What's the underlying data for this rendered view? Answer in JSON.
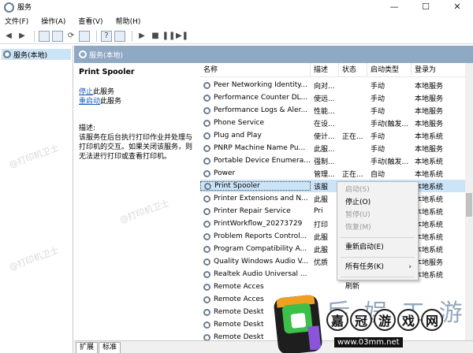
{
  "window": {
    "title": "服务",
    "controls": [
      "—",
      "☐",
      "✕"
    ]
  },
  "menu": [
    "文件(F)",
    "操作(A)",
    "查看(V)",
    "帮助(H)"
  ],
  "tree": {
    "item": "服务(本地)"
  },
  "right_header": "服务(本地)",
  "details": {
    "service_name": "Print Spooler",
    "stop_link": "停止",
    "stop_suffix": "此服务",
    "restart_link": "重启动",
    "restart_suffix": "此服务",
    "desc_label": "描述:",
    "desc_text": "该服务在后台执行打印作业并处理与打印机的交互。如果关闭该服务，则无法进行打印或查看打印机。"
  },
  "columns": [
    "名称",
    "描述",
    "状态",
    "启动类型",
    "登录为"
  ],
  "rows": [
    [
      "Peer Networking Identity...",
      "向对...",
      "",
      "手动",
      "本地服务"
    ],
    [
      "Performance Counter DL...",
      "使远...",
      "",
      "手动",
      "本地服务"
    ],
    [
      "Performance Logs & Aler...",
      "性能...",
      "",
      "手动",
      "本地服务"
    ],
    [
      "Phone Service",
      "在设...",
      "",
      "手动(触发...",
      "本地服务"
    ],
    [
      "Plug and Play",
      "使计...",
      "正在...",
      "手动",
      "本地系统"
    ],
    [
      "PNRP Machine Name Pu...",
      "此服...",
      "",
      "手动",
      "本地服务"
    ],
    [
      "Portable Device Enumera...",
      "强制...",
      "",
      "手动(触发...",
      "本地系统"
    ],
    [
      "Power",
      "管理...",
      "正在...",
      "自动",
      "本地系统"
    ],
    [
      "Print Spooler",
      "该服",
      "",
      "",
      "本地系统"
    ],
    [
      "Printer Extensions and N...",
      "此服",
      "",
      "",
      "本地系统"
    ],
    [
      "Printer Repair Service",
      "Pri",
      "",
      "",
      "本地系统"
    ],
    [
      "PrintWorkflow_20273729",
      "打印",
      "",
      "",
      "本地系统"
    ],
    [
      "Problem Reports Control...",
      "此服",
      "",
      "",
      "本地系统"
    ],
    [
      "Program Compatibility A...",
      "此服",
      "",
      "",
      "本地系统"
    ],
    [
      "Quality Windows Audio V...",
      "优质",
      "",
      "",
      "本地服务"
    ],
    [
      "Realtek Audio Universal ...",
      "",
      "",
      "",
      "本地系统"
    ],
    [
      "Remote Acces",
      "",
      "",
      "",
      ""
    ],
    [
      "Remote Acces",
      "",
      "",
      "",
      ""
    ],
    [
      "Remote Deskt",
      "",
      "",
      "",
      ""
    ],
    [
      "Remote Deskt",
      "",
      "",
      "",
      ""
    ],
    [
      "Remote Deskt",
      "",
      "",
      "",
      ""
    ]
  ],
  "selected_row": 8,
  "context_menu": {
    "items": [
      {
        "label": "启动(S)",
        "disabled": true
      },
      {
        "label": "停止(O)",
        "disabled": false
      },
      {
        "label": "暂停(U)",
        "disabled": true
      },
      {
        "label": "恢复(M)",
        "disabled": true
      },
      {
        "label": "重新启动(E)",
        "disabled": false
      },
      {
        "label": "所有任务(K)",
        "disabled": false,
        "submenu": true
      },
      {
        "label": "刷新",
        "disabled": false
      }
    ]
  },
  "tabs": [
    "扩展",
    "标准"
  ],
  "watermark": {
    "big_text": "后 娱 工 游",
    "brand": [
      "嘉",
      "冠",
      "游",
      "戏",
      "网"
    ],
    "url": "www.03mm.net",
    "ghost": "@打印机卫士"
  }
}
